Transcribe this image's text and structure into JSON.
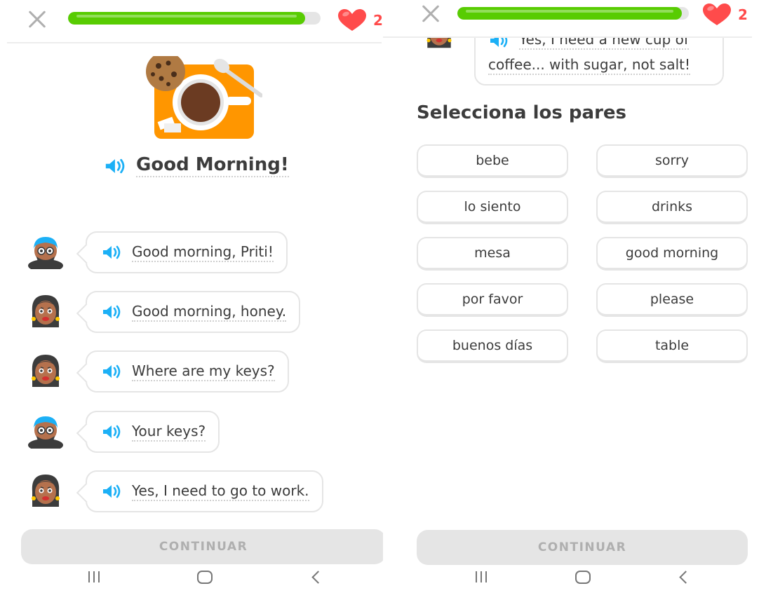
{
  "colors": {
    "progress_green": "#58cc02",
    "heart_red": "#ff4b4b",
    "speaker_blue": "#1cb0f6",
    "button_disabled": "#e5e5e5",
    "button_text_disabled": "#afafaf"
  },
  "left": {
    "progress": 0.94,
    "hearts_count": "2",
    "title": "Good Morning!",
    "dialog": [
      {
        "speaker": "man",
        "text": "Good morning, Priti!"
      },
      {
        "speaker": "woman",
        "text": "Good morning, honey."
      },
      {
        "speaker": "woman",
        "text": "Where are my keys?"
      },
      {
        "speaker": "man",
        "text": "Your keys?"
      },
      {
        "speaker": "woman",
        "text": "Yes, I need to go to work."
      }
    ],
    "continue_label": "CONTINUAR"
  },
  "right": {
    "progress": 0.97,
    "hearts_count": "2",
    "previous_bubble": {
      "line1": "Yes, I need a new cup of",
      "line2": "coffee... with sugar, not salt!"
    },
    "exercise_title": "Selecciona los pares",
    "pairs_left": [
      "bebe",
      "lo siento",
      "mesa",
      "por favor",
      "buenos días"
    ],
    "pairs_right": [
      "sorry",
      "drinks",
      "good morning",
      "please",
      "table"
    ],
    "continue_label": "CONTINUAR"
  },
  "icons": {
    "close": "close-icon",
    "heart": "heart-icon",
    "speaker": "speaker-icon",
    "nav_recent": "recent-apps-icon",
    "nav_home": "home-icon",
    "nav_back": "back-icon"
  }
}
